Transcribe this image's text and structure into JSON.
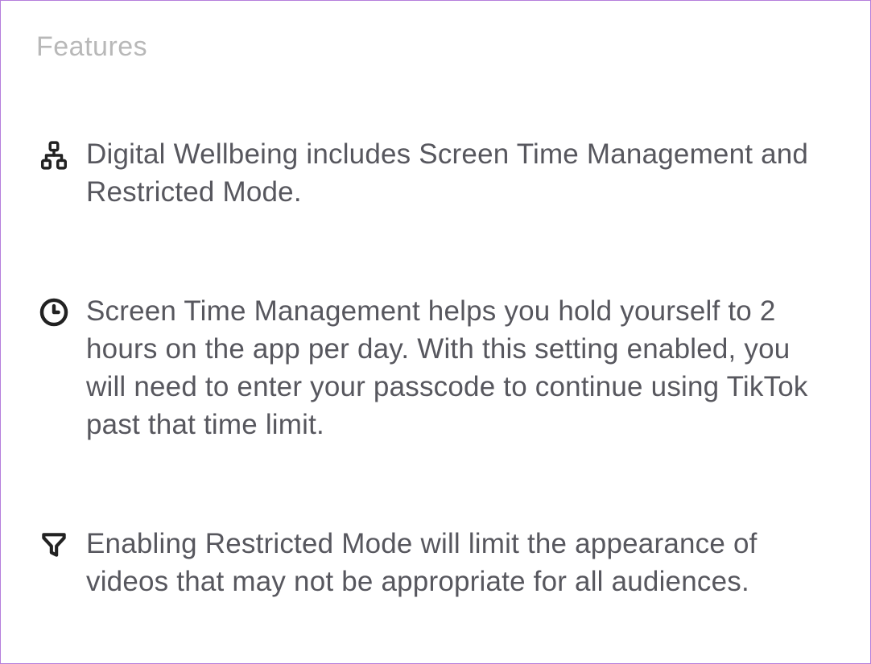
{
  "heading": "Features",
  "features": [
    {
      "icon": "hierarchy-icon",
      "text": "Digital Wellbeing includes Screen Time Management and Restricted Mode."
    },
    {
      "icon": "clock-icon",
      "text": "Screen Time Management helps you hold yourself to 2 hours on the app per day. With this setting enabled, you will need to enter your passcode to continue using TikTok past that time limit."
    },
    {
      "icon": "filter-icon",
      "text": "Enabling Restricted Mode will limit the appearance of videos that may not be appropriate for all audiences."
    }
  ]
}
